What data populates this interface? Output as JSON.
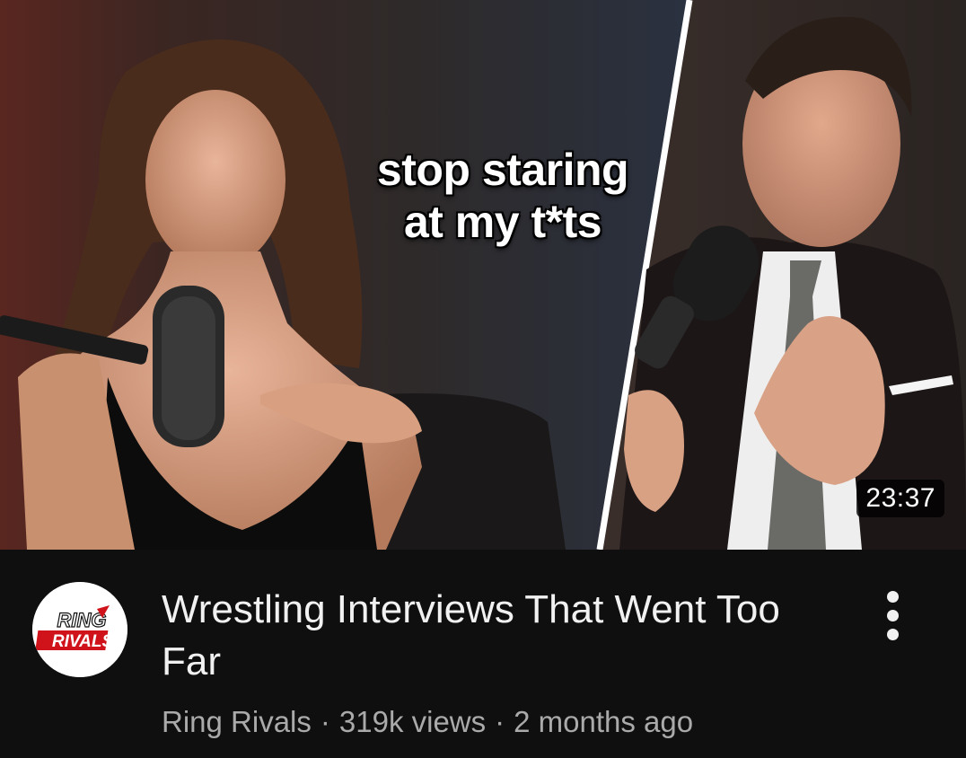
{
  "video": {
    "thumbnail_overlay_line1": "stop staring",
    "thumbnail_overlay_line2": "at my t*ts",
    "duration": "23:37",
    "title": "Wrestling Interviews That Went Too Far",
    "channel": "Ring Rivals",
    "views": "319k views",
    "age": "2 months ago",
    "separator": "·",
    "avatar_logo_text_1": "RING",
    "avatar_logo_text_2": "RIVALS",
    "more_icon": "vertical-ellipsis-icon"
  },
  "colors": {
    "background": "#0f0f0f",
    "title_text": "#f1f1f1",
    "meta_text": "#aaaaaa",
    "logo_red": "#d0121b"
  }
}
